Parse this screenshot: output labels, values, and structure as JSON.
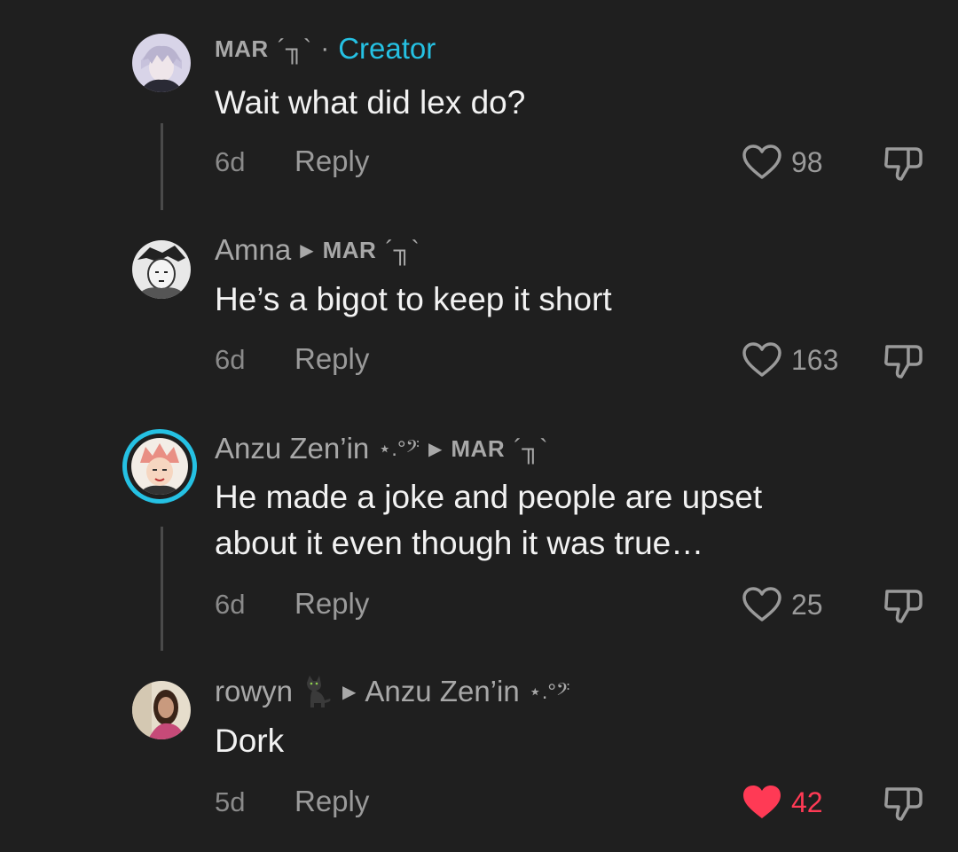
{
  "comments": [
    {
      "username": "MAR",
      "username_deco": "´╖`",
      "separator": "·",
      "creator_label": "Creator",
      "text": "Wait what did lex do?",
      "time": "6d",
      "reply_label": "Reply",
      "likes": "98",
      "liked": false
    },
    {
      "username": "Amna",
      "reply_to_arrow": "▶",
      "reply_to": "MAR",
      "reply_to_deco": "´╖`",
      "text": "He’s a bigot to keep it short",
      "time": "6d",
      "reply_label": "Reply",
      "likes": "163",
      "liked": false
    },
    {
      "username": "Anzu Zen’in",
      "username_deco": "⋆.°𝄢",
      "reply_to_arrow": "▶",
      "reply_to": "MAR",
      "reply_to_deco": "´╖`",
      "text_line1": "He made a joke and people are upset",
      "text_line2": "about it even though it was true…",
      "time": "6d",
      "reply_label": "Reply",
      "likes": "25",
      "liked": false
    },
    {
      "username": "rowyn",
      "username_icon": "black-cat-icon",
      "reply_to_arrow": "▶",
      "reply_to": "Anzu Zen’in",
      "reply_to_deco": "⋆.°𝄢",
      "text": "Dork",
      "time": "5d",
      "reply_label": "Reply",
      "likes": "42",
      "liked": true
    }
  ],
  "colors": {
    "background": "#1f1f1f",
    "creator": "#25c1e3",
    "liked": "#ff3a55",
    "muted": "#a8a8a8",
    "text": "#f2f2f2"
  }
}
